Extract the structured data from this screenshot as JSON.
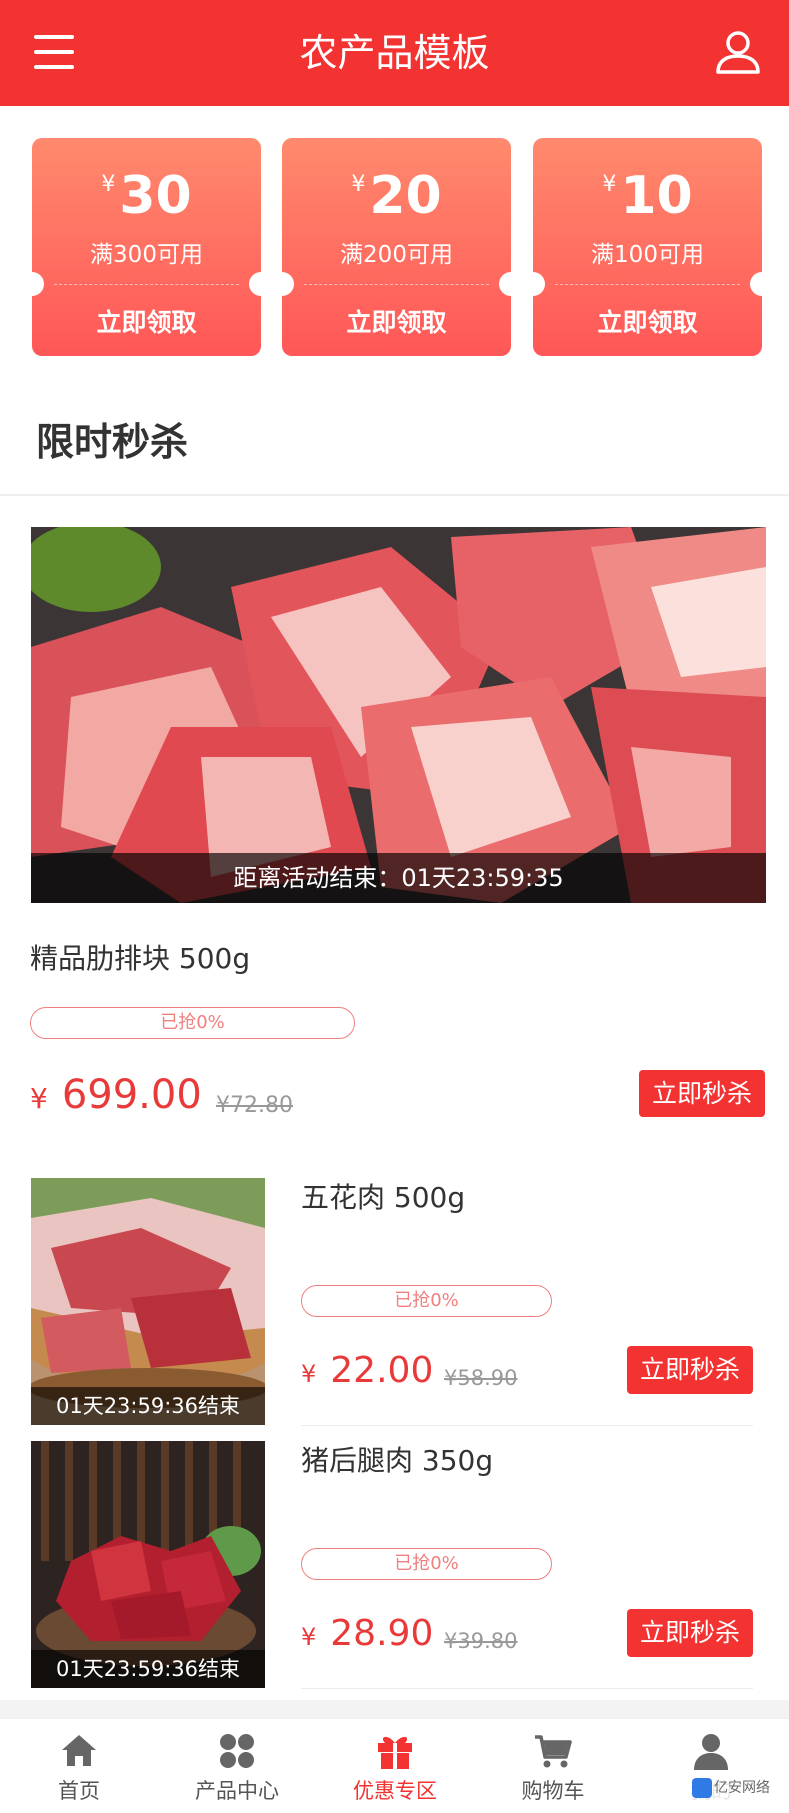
{
  "header": {
    "title": "农产品模板"
  },
  "coupons": [
    {
      "symbol": "¥",
      "amount": "30",
      "condition": "满300可用",
      "action": "立即领取"
    },
    {
      "symbol": "¥",
      "amount": "20",
      "condition": "满200可用",
      "action": "立即领取"
    },
    {
      "symbol": "¥",
      "amount": "10",
      "condition": "满100可用",
      "action": "立即领取"
    }
  ],
  "section": {
    "title": "限时秒杀"
  },
  "featured": {
    "countdown": "距离活动结束：01天23:59:35",
    "name": "精品肋排块 500g",
    "progress_label": "已抢0%",
    "progress": 0,
    "currency": "¥",
    "price": "699.00",
    "old_price": "¥72.80",
    "button": "立即秒杀"
  },
  "items": [
    {
      "name": "五花肉 500g",
      "countdown": "01天23:59:36结束",
      "progress_label": "已抢0%",
      "progress": 0,
      "currency": "¥",
      "price": "22.00",
      "old_price": "¥58.90",
      "button": "立即秒杀"
    },
    {
      "name": "猪后腿肉 350g",
      "countdown": "01天23:59:36结束",
      "progress_label": "已抢0%",
      "progress": 0,
      "currency": "¥",
      "price": "28.90",
      "old_price": "¥39.80",
      "button": "立即秒杀"
    }
  ],
  "tabbar": [
    {
      "label": "首页",
      "icon": "home-icon",
      "active": false
    },
    {
      "label": "产品中心",
      "icon": "grid-icon",
      "active": false
    },
    {
      "label": "优惠专区",
      "icon": "gift-icon",
      "active": true
    },
    {
      "label": "购物车",
      "icon": "cart-icon",
      "active": false
    },
    {
      "label": "我的",
      "icon": "person-icon",
      "active": false
    }
  ],
  "colors": {
    "primary": "#f33232",
    "coupon_top": "#ff8a6d",
    "coupon_bottom": "#ff5757",
    "price": "#e93a3a"
  },
  "watermark": "亿安网络"
}
